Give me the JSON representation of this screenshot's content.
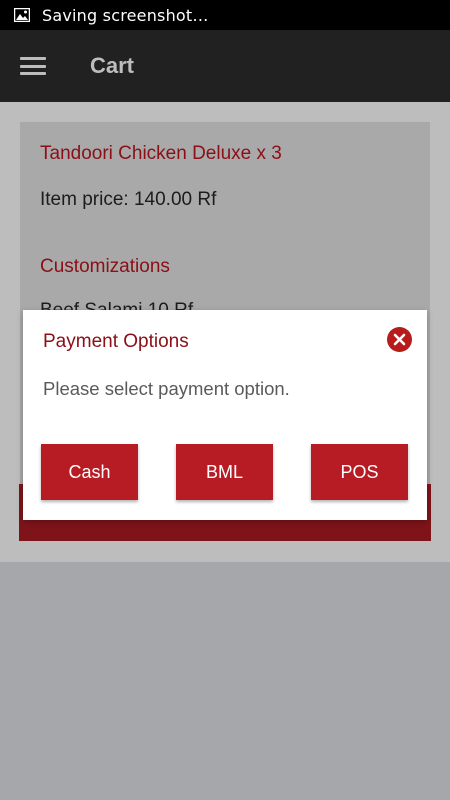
{
  "status_bar": {
    "text": "Saving screenshot…",
    "icon": "image-icon"
  },
  "app_bar": {
    "title": "Cart",
    "menu_icon": "hamburger-menu-icon"
  },
  "cart_item": {
    "name": "Tandoori Chicken Deluxe x 3",
    "price": "Item price: 140.00 Rf",
    "customizations_title": "Customizations",
    "customization_line": "Beef Salami 10 Rf"
  },
  "dialog": {
    "title": "Payment Options",
    "message": "Please select payment option.",
    "close_icon": "close-circle-icon",
    "buttons": [
      "Cash",
      "BML",
      "POS"
    ]
  },
  "colors": {
    "accent": "#b71c24",
    "title_red": "#8b0f17",
    "app_bar": "#212121"
  }
}
